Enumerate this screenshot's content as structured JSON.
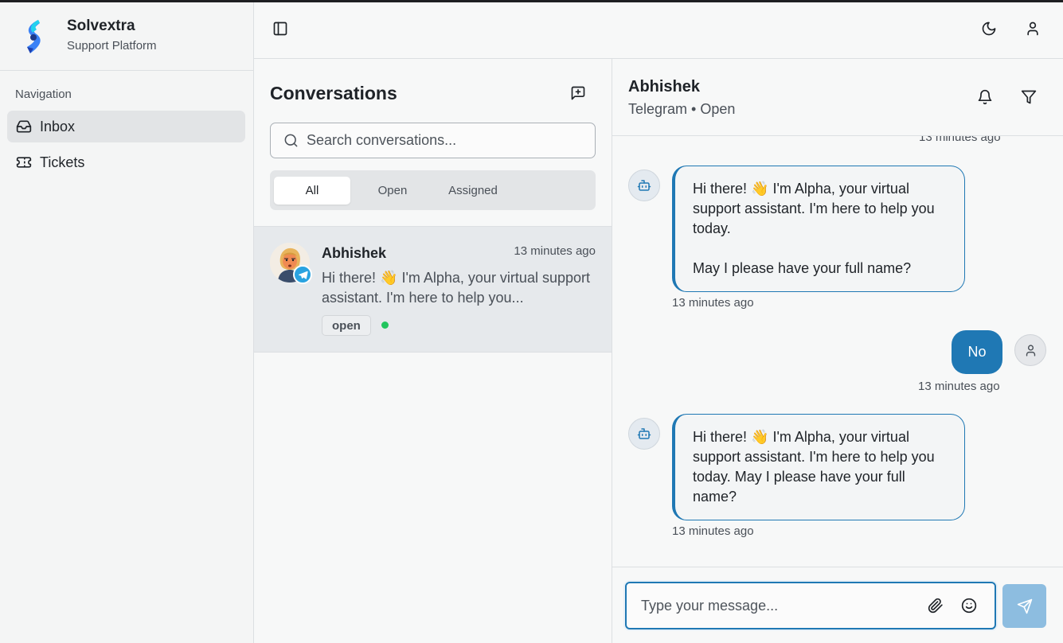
{
  "brand": {
    "name": "Solvextra",
    "subtitle": "Support Platform"
  },
  "sidebar": {
    "section_label": "Navigation",
    "items": [
      {
        "label": "Inbox",
        "icon": "inbox-icon",
        "active": true
      },
      {
        "label": "Tickets",
        "icon": "ticket-icon",
        "active": false
      }
    ]
  },
  "header": {
    "icons": [
      "sidebar-toggle-icon",
      "moon-icon",
      "user-icon"
    ]
  },
  "conversations": {
    "title": "Conversations",
    "search_placeholder": "Search conversations...",
    "tabs": [
      {
        "label": "All",
        "active": true
      },
      {
        "label": "Open",
        "active": false
      },
      {
        "label": "Assigned",
        "active": false
      }
    ],
    "items": [
      {
        "name": "Abhishek",
        "time": "13 minutes ago",
        "preview": "Hi there! 👋 I'm Alpha, your virtual support assistant. I'm here to help you...",
        "status": "open",
        "channel": "Telegram"
      }
    ]
  },
  "chat": {
    "contact_name": "Abhishek",
    "channel": "Telegram",
    "status": "Open",
    "subtitle": "Telegram • Open",
    "top_timestamp": "13 minutes ago",
    "messages": [
      {
        "sender": "bot",
        "text": "Hi there! 👋 I'm Alpha, your virtual support assistant. I'm here to help you today.\n\nMay I please have your full name?",
        "time": "13 minutes ago"
      },
      {
        "sender": "user",
        "text": "No",
        "time": "13 minutes ago"
      },
      {
        "sender": "bot",
        "text": "Hi there! 👋 I'm Alpha, your virtual support assistant. I'm here to help you today. May I please have your full name?",
        "time": "13 minutes ago"
      }
    ],
    "composer_placeholder": "Type your message..."
  },
  "colors": {
    "accent": "#1f78b4",
    "send_button": "#8dbde0",
    "status_online": "#22c55e",
    "telegram": "#2aa3e0"
  }
}
